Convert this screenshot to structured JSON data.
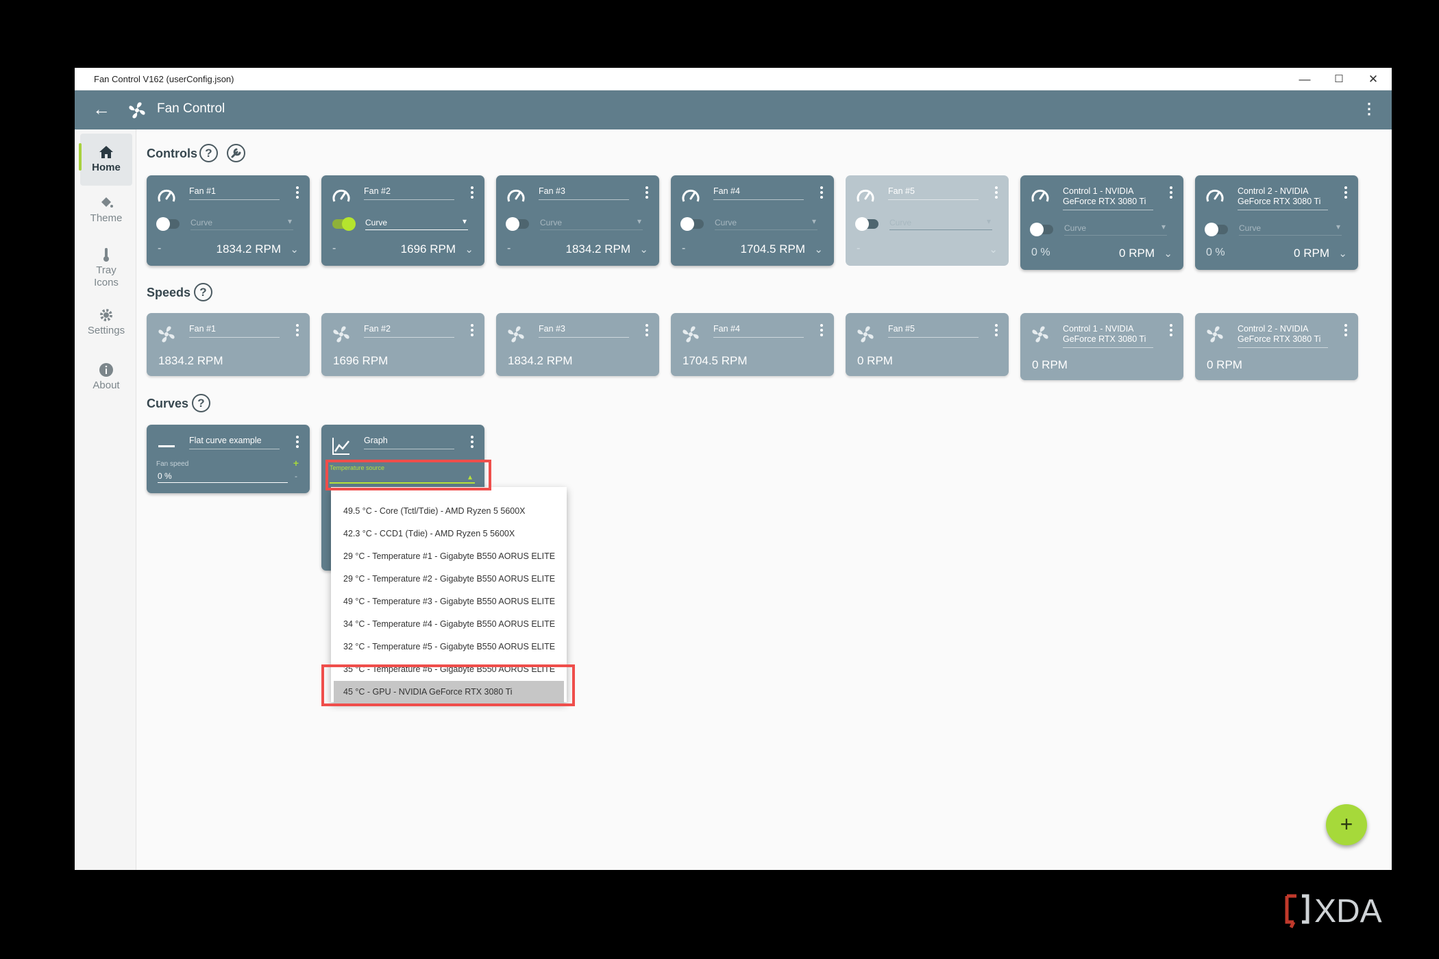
{
  "window": {
    "title": "Fan Control V162 (userConfig.json)",
    "minimize": "—",
    "maximize": "☐",
    "close": "✕"
  },
  "appbar": {
    "title": "Fan Control",
    "back": "←",
    "menu": "⋮"
  },
  "nav": [
    {
      "label": "Home",
      "icon": "home-icon",
      "active": true
    },
    {
      "label": "Theme",
      "icon": "paint-bucket-icon"
    },
    {
      "label": "Tray Icons",
      "icon": "thermometer-icon"
    },
    {
      "label": "Settings",
      "icon": "gear-icon"
    },
    {
      "label": "About",
      "icon": "info-icon"
    }
  ],
  "sections": {
    "controls": "Controls",
    "speeds": "Speeds",
    "curves": "Curves",
    "help": "?"
  },
  "controls": [
    {
      "name": "Fan #1",
      "mode": "Curve",
      "pct": "-",
      "rpm": "1834.2 RPM",
      "enabled": false
    },
    {
      "name": "Fan #2",
      "mode": "Curve",
      "pct": "-",
      "rpm": "1696 RPM",
      "enabled": true
    },
    {
      "name": "Fan #3",
      "mode": "Curve",
      "pct": "-",
      "rpm": "1834.2 RPM",
      "enabled": false
    },
    {
      "name": "Fan #4",
      "mode": "Curve",
      "pct": "-",
      "rpm": "1704.5 RPM",
      "enabled": false
    },
    {
      "name": "Fan #5",
      "mode": "Curve",
      "pct": "-",
      "rpm": "",
      "enabled": false,
      "disabled": true
    },
    {
      "name": "Control 1 - NVIDIA GeForce RTX 3080 Ti",
      "mode": "Curve",
      "pct": "0 %",
      "rpm": "0 RPM",
      "enabled": false
    },
    {
      "name": "Control 2 - NVIDIA GeForce RTX 3080 Ti",
      "mode": "Curve",
      "pct": "0 %",
      "rpm": "0 RPM",
      "enabled": false
    }
  ],
  "speeds": [
    {
      "name": "Fan #1",
      "value": "1834.2 RPM"
    },
    {
      "name": "Fan #2",
      "value": "1696 RPM"
    },
    {
      "name": "Fan #3",
      "value": "1834.2 RPM"
    },
    {
      "name": "Fan #4",
      "value": "1704.5 RPM"
    },
    {
      "name": "Fan #5",
      "value": "0 RPM"
    },
    {
      "name": "Control 1 - NVIDIA GeForce RTX 3080 Ti",
      "value": "0 RPM"
    },
    {
      "name": "Control 2 - NVIDIA GeForce RTX 3080 Ti",
      "value": "0 RPM"
    }
  ],
  "curves": {
    "flat": {
      "name": "Flat curve example",
      "field_label": "Fan speed",
      "value": "0 %",
      "plus": "+",
      "minus": "-"
    },
    "graph": {
      "name": "Graph",
      "field_label": "Temperature source",
      "caret": "▴"
    }
  },
  "temperature_options": [
    "49.5 °C - Core (Tctl/Tdie) - AMD Ryzen 5 5600X",
    "42.3 °C - CCD1 (Tdie) - AMD Ryzen 5 5600X",
    "29 °C - Temperature #1 - Gigabyte B550 AORUS ELITE",
    "29 °C - Temperature #2 - Gigabyte B550 AORUS ELITE",
    "49 °C - Temperature #3 - Gigabyte B550 AORUS ELITE",
    "34 °C - Temperature #4 - Gigabyte B550 AORUS ELITE",
    "32 °C - Temperature #5 - Gigabyte B550 AORUS ELITE",
    "35 °C - Temperature #6 - Gigabyte B550 AORUS ELITE",
    "45 °C - GPU - NVIDIA GeForce RTX 3080 Ti"
  ],
  "selected_option_index": 8,
  "fab": {
    "label": "+"
  },
  "watermark": {
    "text": "XDA"
  },
  "colors": {
    "accent": "#a6d93a",
    "card": "#607d8b",
    "highlight": "#ef4e4b"
  }
}
